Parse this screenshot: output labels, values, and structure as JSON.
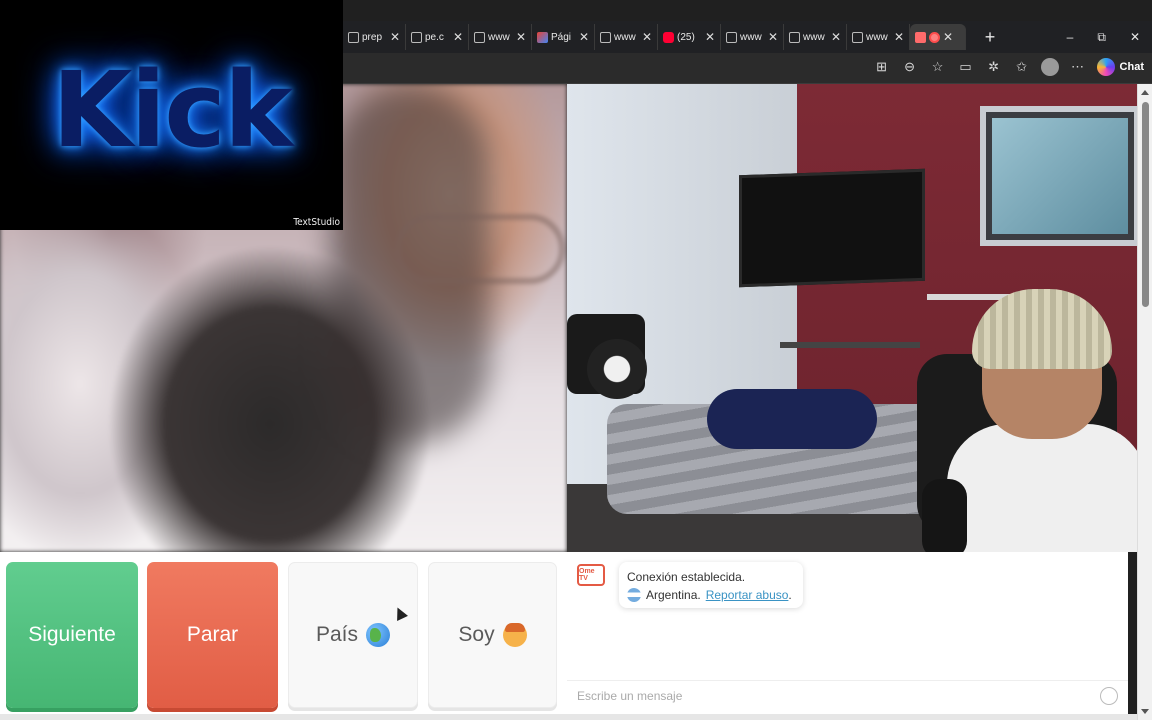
{
  "overlay": {
    "kick_text": "Kick",
    "watermark": "TextStudio"
  },
  "browser": {
    "tabs": [
      {
        "label": "prep",
        "icon": "page-icon"
      },
      {
        "label": "pe.c",
        "icon": "page-icon"
      },
      {
        "label": "www",
        "icon": "page-icon"
      },
      {
        "label": "Pági",
        "icon": "gmail-icon"
      },
      {
        "label": "www",
        "icon": "page-icon"
      },
      {
        "label": "(25)",
        "icon": "youtube-icon"
      },
      {
        "label": "www",
        "icon": "page-icon"
      },
      {
        "label": "www",
        "icon": "page-icon"
      },
      {
        "label": "www",
        "icon": "page-icon"
      }
    ],
    "window_controls": {
      "minimize": "–",
      "restore": "⧉",
      "close": "✕"
    },
    "new_tab": "+",
    "chat_label": "Chat"
  },
  "controls": {
    "next_label": "Siguiente",
    "stop_label": "Parar",
    "country_label": "País",
    "me_label": "Soy"
  },
  "chat": {
    "logo_text": "Ome TV",
    "status": "Conexión establecida.",
    "country": "Argentina.",
    "report_link": "Reportar abuso",
    "report_suffix": ".",
    "placeholder": "Escribe un mensaje"
  },
  "colors": {
    "next": "#4fc07f",
    "stop": "#e8674f",
    "link": "#3a93c4",
    "kick_glow": "#1e88ff"
  }
}
